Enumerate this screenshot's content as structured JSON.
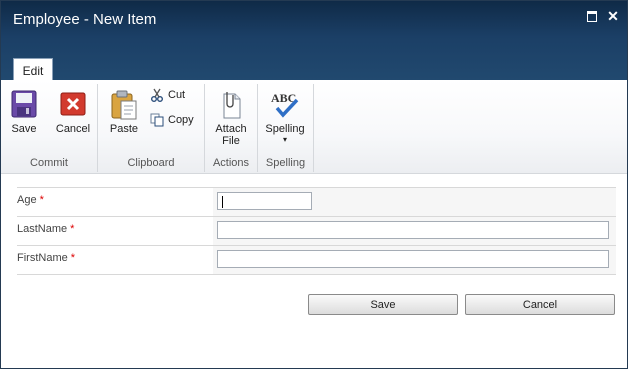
{
  "window": {
    "title": "Employee - New Item",
    "maximize_icon": "maximize-icon",
    "close_glyph": "✕"
  },
  "ribbon": {
    "tab_label": "Edit",
    "groups": {
      "commit": "Commit",
      "clipboard": "Clipboard",
      "actions": "Actions",
      "spelling": "Spelling"
    },
    "buttons": {
      "save": "Save",
      "cancel": "Cancel",
      "paste": "Paste",
      "cut": "Cut",
      "copy": "Copy",
      "attach_line1": "Attach",
      "attach_line2": "File",
      "spelling": "Spelling",
      "spelling_dropdown": "▾",
      "spelling_icon_text": "ABC"
    }
  },
  "form": {
    "required_marker": "*",
    "fields": [
      {
        "label": "Age",
        "value": ""
      },
      {
        "label": "LastName",
        "value": ""
      },
      {
        "label": "FirstName",
        "value": ""
      }
    ],
    "save_label": "Save",
    "cancel_label": "Cancel"
  },
  "colors": {
    "title_bar": "#1b3f66",
    "required": "#dd0000"
  }
}
